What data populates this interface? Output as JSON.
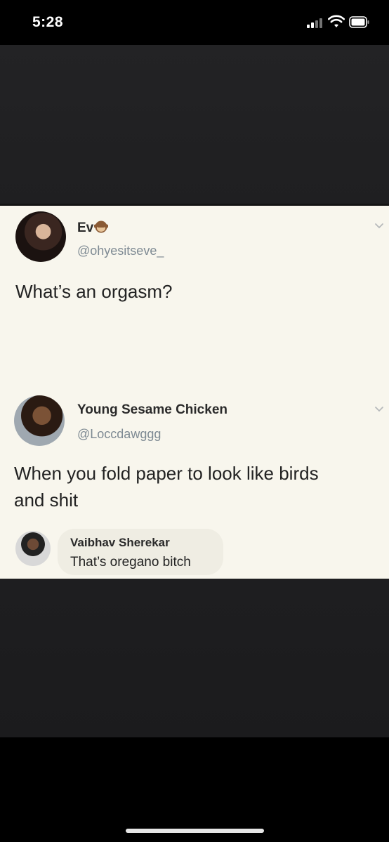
{
  "status_bar": {
    "time": "5:28",
    "signal_icon": "signal-bars-icon",
    "wifi_icon": "wifi-icon",
    "battery_icon": "battery-icon"
  },
  "tweet": {
    "display_name": "Ev",
    "name_emoji": "monkey-emoji-icon",
    "handle": "@ohyesitseve_",
    "text": "What’s an orgasm?",
    "menu_icon": "chevron-down-icon"
  },
  "reply_tweet": {
    "display_name": "Young Sesame Chicken",
    "handle": "@Loccdawggg",
    "text_line1": "When you fold paper to look like birds",
    "text_line2": "and shit",
    "menu_icon": "chevron-down-icon"
  },
  "comment": {
    "author": "Vaibhav Sherekar",
    "text": "That’s oregano bitch"
  },
  "colors": {
    "card_background": "#f8f6ed",
    "handle_gray": "#7e8a93",
    "photo_dark": "#212123"
  }
}
